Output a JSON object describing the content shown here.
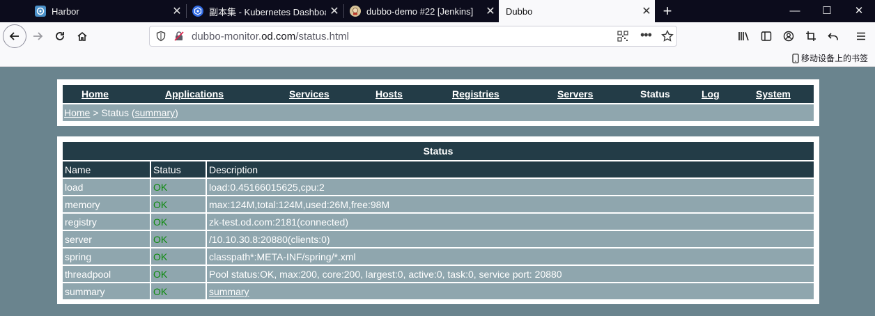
{
  "browser": {
    "tabs": [
      {
        "title": "Harbor",
        "active": false,
        "icon": "harbor-icon"
      },
      {
        "title": "副本集 - Kubernetes Dashboard",
        "active": false,
        "icon": "kubernetes-icon"
      },
      {
        "title": "dubbo-demo #22 [Jenkins]",
        "active": false,
        "icon": "jenkins-icon"
      },
      {
        "title": "Dubbo",
        "active": true,
        "icon": ""
      }
    ],
    "url_host_prefix": "dubbo-monitor.",
    "url_host_domain": "od.com",
    "url_path": "/status.html",
    "mobile_bookmarks": "移动设备上的书签"
  },
  "nav": {
    "items": [
      {
        "label": "Home",
        "current": false
      },
      {
        "label": "Applications",
        "current": false
      },
      {
        "label": "Services",
        "current": false
      },
      {
        "label": "Hosts",
        "current": false
      },
      {
        "label": "Registries",
        "current": false
      },
      {
        "label": "Servers",
        "current": false
      },
      {
        "label": "Status",
        "current": true
      },
      {
        "label": "Log",
        "current": false
      },
      {
        "label": "System",
        "current": false
      }
    ]
  },
  "breadcrumb": {
    "home": "Home",
    "separator": " > Status (",
    "summary": "summary",
    "close": ")"
  },
  "status_table": {
    "title": "Status",
    "columns": [
      "Name",
      "Status",
      "Description"
    ],
    "rows": [
      {
        "name": "load",
        "status": "OK",
        "description": "load:0.45166015625,cpu:2"
      },
      {
        "name": "memory",
        "status": "OK",
        "description": "max:124M,total:124M,used:26M,free:98M"
      },
      {
        "name": "registry",
        "status": "OK",
        "description": "zk-test.od.com:2181(connected)"
      },
      {
        "name": "server",
        "status": "OK",
        "description": "/10.10.30.8:20880(clients:0)"
      },
      {
        "name": "spring",
        "status": "OK",
        "description": "classpath*:META-INF/spring/*.xml"
      },
      {
        "name": "threadpool",
        "status": "OK",
        "description": "Pool status:OK, max:200, core:200, largest:0, active:0, task:0, service port: 20880"
      },
      {
        "name": "summary",
        "status": "OK",
        "description": "summary"
      }
    ]
  },
  "colors": {
    "header_bg": "#233c47",
    "row_bg": "#8fa6ae",
    "page_bg": "#6a848e",
    "ok": "#0c8a0c"
  }
}
